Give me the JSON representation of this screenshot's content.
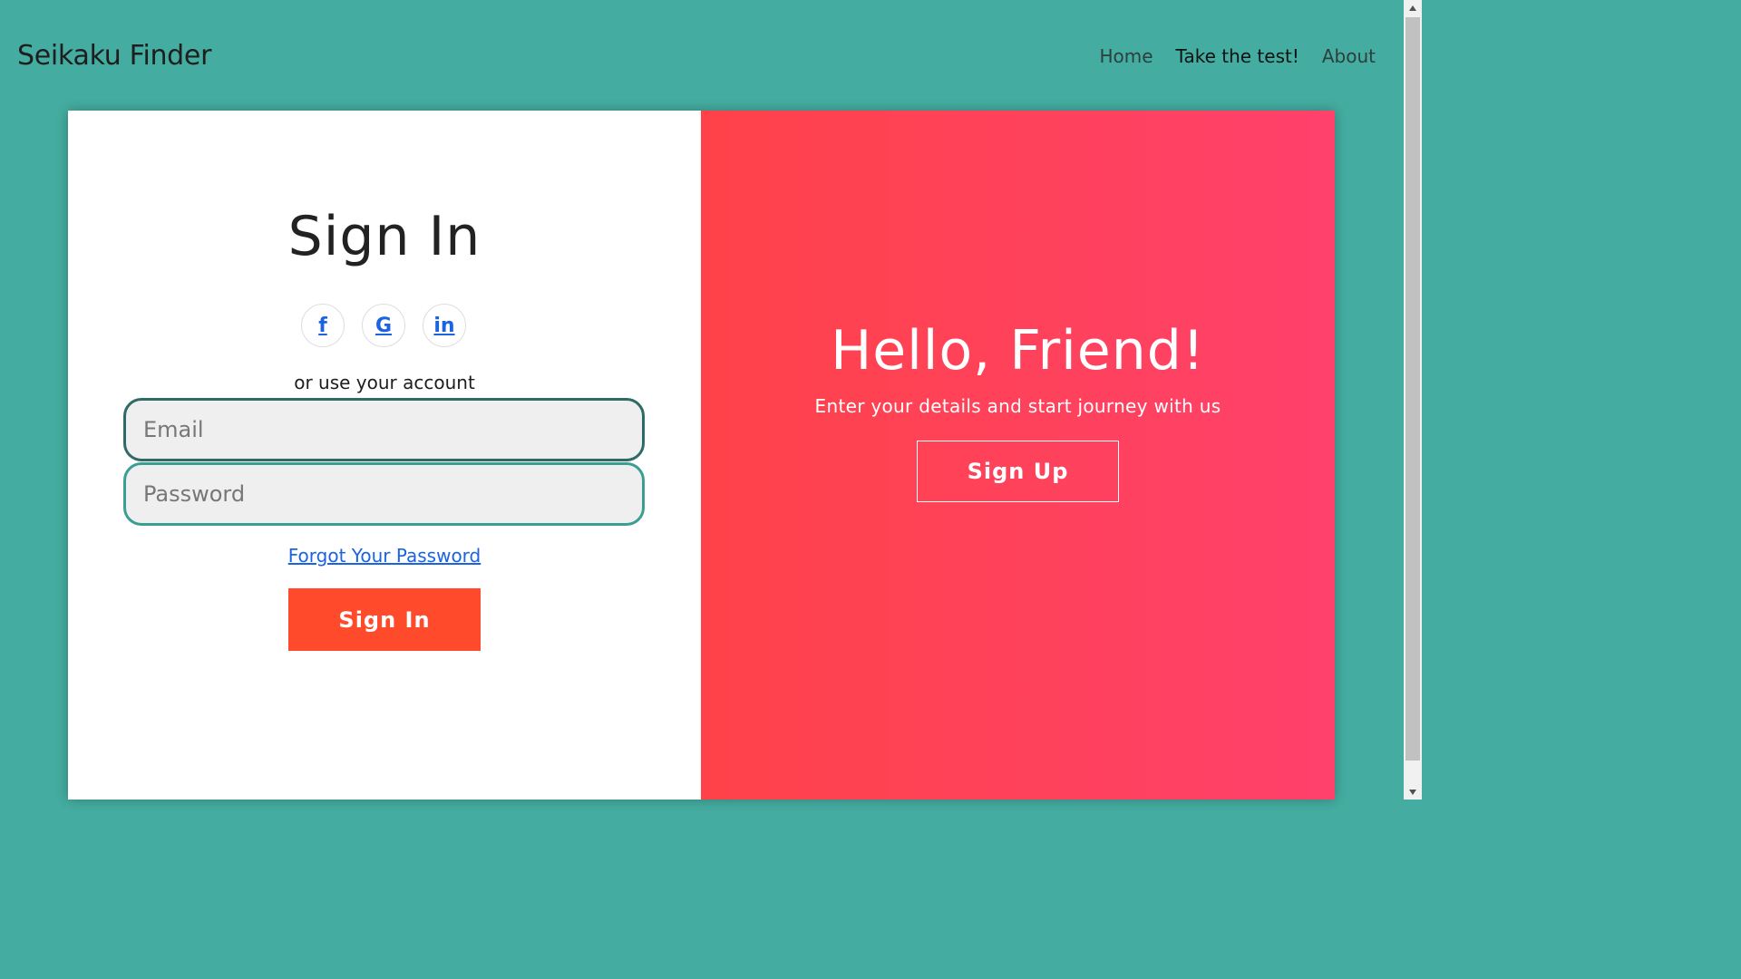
{
  "nav": {
    "brand": "Seikaku Finder",
    "links": [
      "Home",
      "Take the test!",
      "About"
    ]
  },
  "signin": {
    "title": "Sign In",
    "socials": [
      "f",
      "G",
      "in"
    ],
    "social_icons": [
      "facebook-icon",
      "google-icon",
      "linkedin-icon"
    ],
    "or_text": "or use your account",
    "email_placeholder": "Email",
    "password_placeholder": "Password",
    "forgot_label": "Forgot Your Password",
    "button_label": "Sign In"
  },
  "overlay": {
    "title": "Hello, Friend!",
    "subtitle": "Enter your details and start journey with us",
    "button_label": "Sign Up"
  },
  "colors": {
    "background": "#44aca0",
    "sign_in_button": "#ff4b2b",
    "gradient_start": "#ff4249",
    "gradient_end": "#ff416c",
    "link": "#1a64e0"
  }
}
